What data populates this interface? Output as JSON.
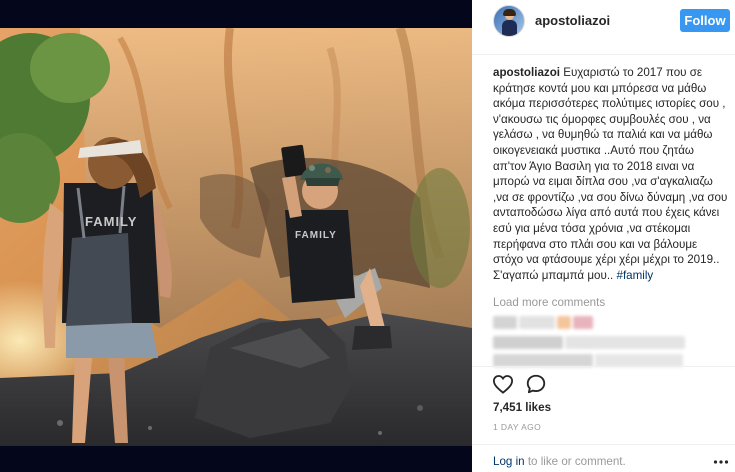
{
  "post": {
    "username": "apostoliazoi",
    "follow_label": "Follow",
    "caption_user": "apostoliazoi",
    "caption_text": "Ευχαριστώ το 2017 που σε κράτησε κοντά μου και μπόρεσα να μάθω ακόμα περισσότερες πολύτιμες ιστορίες σου , ν'ακουσω τις όμορφες συμβουλές σου , να γελάσω , να θυμηθώ τα παλιά και να μάθω οικογενειακά μυστικα ..Αυτό που ζητάω απ'τον Άγιο Βασιλη για το 2018 ειναι να μπορώ να ειμαι δίπλα σου ,να σ'αγκαλιαζω ,να σε φροντίζω ,να σου δίνω δύναμη ,να σου ανταποδώσω λίγα από αυτά που έχεις κάνει εσύ για μένα τόσα χρόνια ,να στέκομαι περήφανα στο πλάι σου και να βάλουμε στόχο να φτάσουμε χέρι χέρι μέχρι το 2019.. Σ'αγαπώ μπαμπά μου..",
    "hashtag": "#family",
    "load_more": "Load more comments",
    "likes": "7,451 likes",
    "timestamp": "1 DAY AGO",
    "login_link": "Log in",
    "login_rest": " to like or comment."
  },
  "photo": {
    "shirt_text": "FAMILY"
  },
  "icons": {
    "like": "heart-outline-icon",
    "comment": "speech-bubble-icon",
    "more": "ellipsis-icon"
  },
  "colors": {
    "follow_bg": "#3897f0",
    "link": "#003569",
    "muted": "#999999",
    "text": "#262626"
  }
}
